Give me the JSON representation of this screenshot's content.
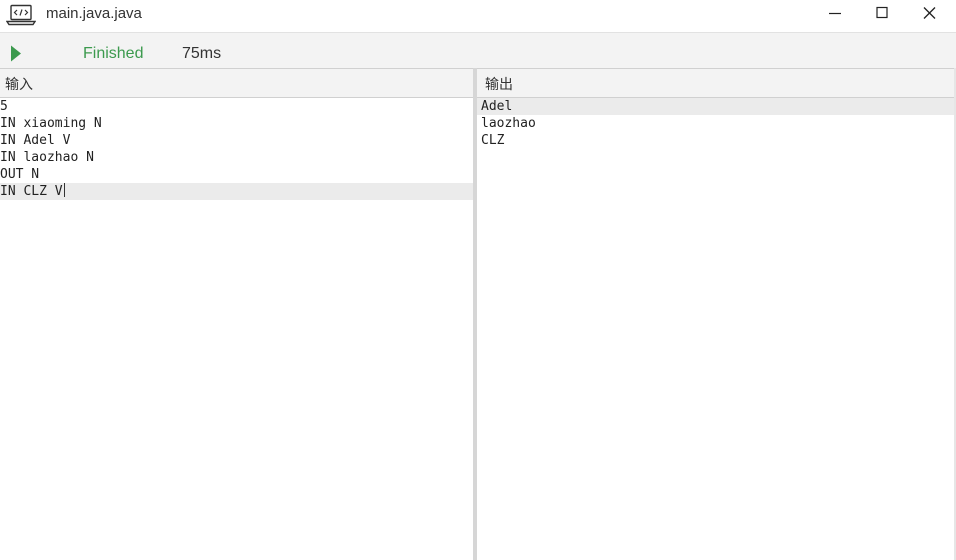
{
  "window": {
    "title": "main.java.java",
    "icon": "laptop-code-icon"
  },
  "toolbar": {
    "status": "Finished",
    "time": "75ms",
    "status_color": "#3c9a4e",
    "run_icon": "play-icon"
  },
  "input_panel": {
    "label": "输入",
    "lines": [
      "5",
      "IN xiaoming N",
      "IN Adel V",
      "IN laozhao N",
      "OUT N",
      "IN CLZ V"
    ]
  },
  "output_panel": {
    "label": "输出",
    "lines": [
      "Adel",
      "laozhao",
      "CLZ"
    ]
  }
}
